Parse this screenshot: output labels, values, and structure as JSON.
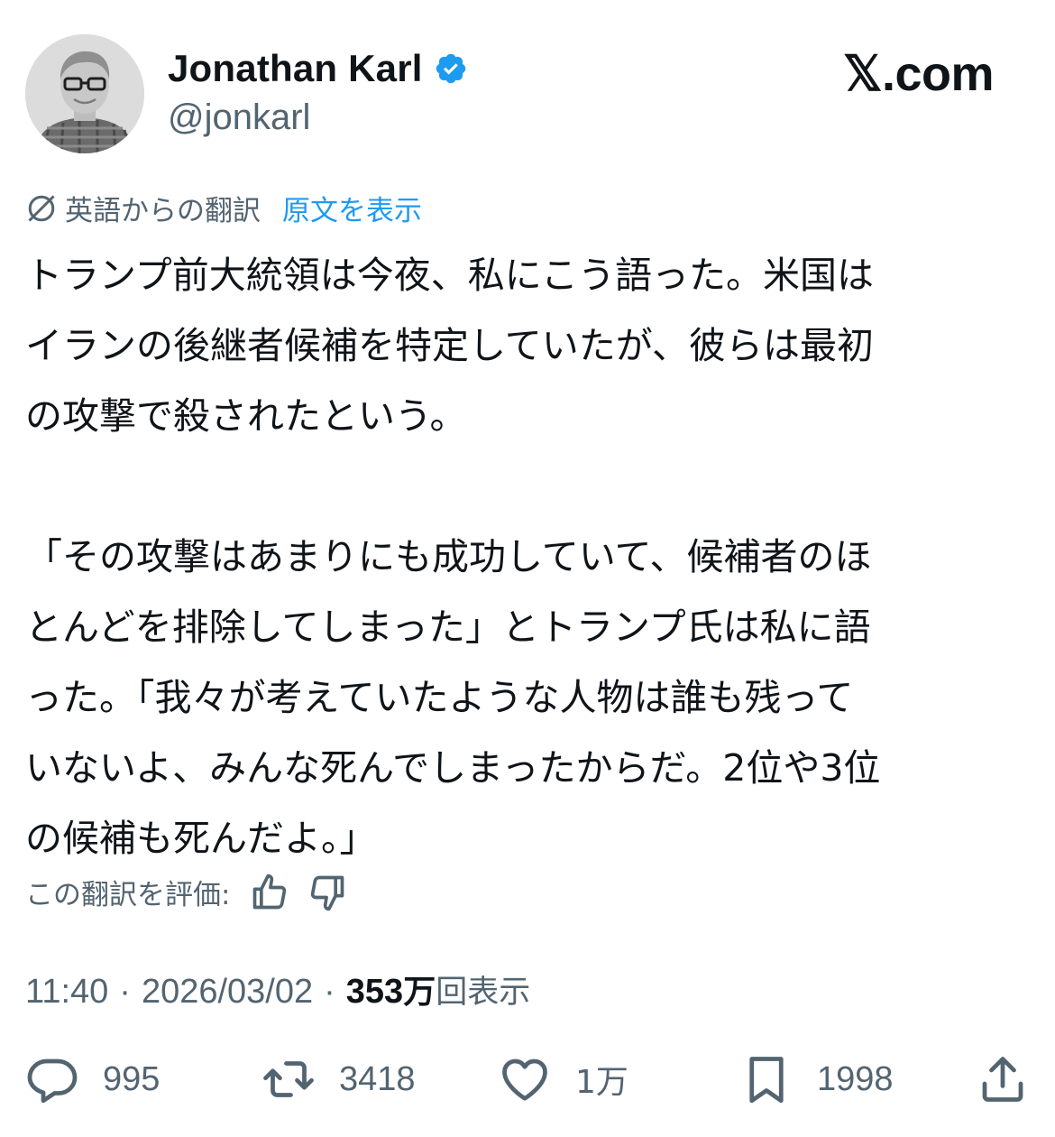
{
  "author": {
    "name": "Jonathan Karl",
    "handle": "@jonkarl",
    "verified_color": "#1d9bf0"
  },
  "site": {
    "logo_text": "𝕏.com"
  },
  "translation": {
    "label": "英語からの翻訳",
    "show_original": "原文を表示",
    "icon": "translate-icon"
  },
  "tweet": {
    "lines": [
      "トランプ前大統領は今夜、私にこう語った。米国は",
      "イランの後継者候補を特定していたが、彼らは最初",
      "の攻撃で殺されたという。",
      "「その攻撃はあまりにも成功していて、候補者のほ",
      "とんどを排除してしまった」とトランプ氏は私に語",
      "った。「我々が考えていたような人物は誰も残って",
      "いないよ、みんな死んでしまったからだ。2位や3位",
      "の候補も死んだよ。」"
    ]
  },
  "rating": {
    "label": "この翻訳を評価:",
    "up_icon": "thumbs-up-icon",
    "down_icon": "thumbs-down-icon"
  },
  "meta": {
    "time": "11:40",
    "separator": "·",
    "date": "2026/03/02",
    "views_number": "353",
    "views_unit": "万",
    "views_label": "回表示"
  },
  "actions": {
    "replies": "995",
    "reposts": "3418",
    "likes": "1万",
    "bookmarks": "1998"
  },
  "colors": {
    "text": "#0f1419",
    "secondary": "#536471",
    "accent": "#1d9bf0"
  }
}
